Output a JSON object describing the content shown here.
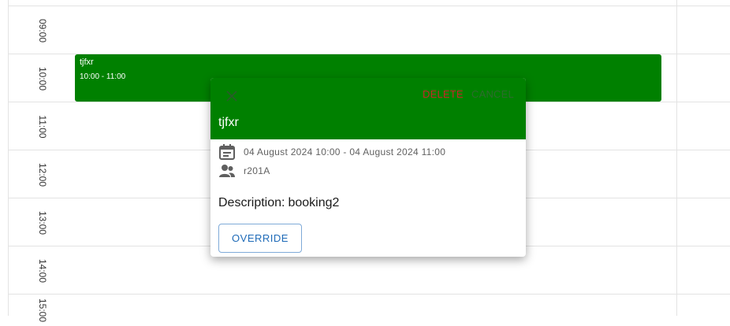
{
  "timeslots": [
    "09:00",
    "10:00",
    "11:00",
    "12:00",
    "13:00",
    "14:00",
    "15:00"
  ],
  "event": {
    "title": "tjfxr",
    "time_range": "10:00 - 11:00",
    "color": "#008000"
  },
  "popup": {
    "close_icon": "close-icon",
    "delete_label": "DELETE",
    "cancel_label": "CANCEL",
    "title": "tjfxr",
    "date_range": "04 August 2024 10:00 - 04 August 2024 11:00",
    "resource": "r201A",
    "description_label": "Description:",
    "description_value": "booking2",
    "override_label": "OVERRIDE"
  },
  "colors": {
    "header_bg": "#008000",
    "delete": "#c62828",
    "override_text": "#1f6bb8"
  }
}
